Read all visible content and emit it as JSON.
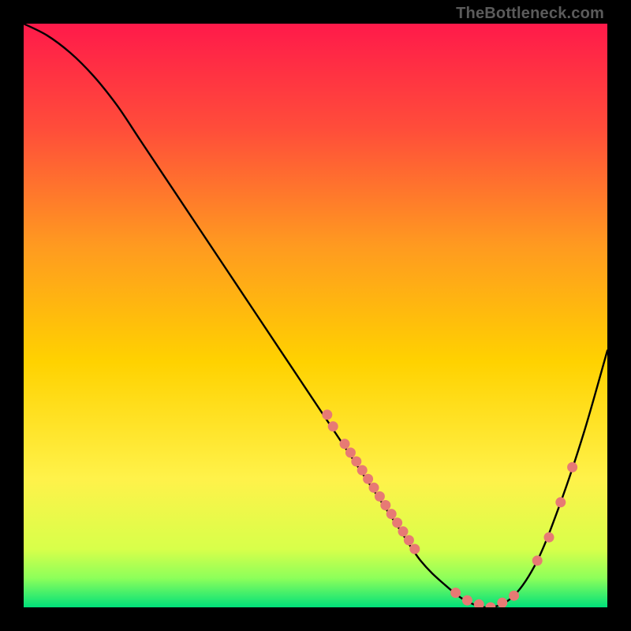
{
  "watermark": "TheBottleneck.com",
  "colors": {
    "gradient_top": "#ff1a4a",
    "gradient_mid1": "#ff6a2e",
    "gradient_mid2": "#ffd200",
    "gradient_mid3": "#fff24a",
    "gradient_bottom1": "#b6ff5a",
    "gradient_bottom2": "#00e07a",
    "curve": "#000000",
    "dot": "#e77a74",
    "frame": "#000000"
  },
  "chart_data": {
    "type": "line",
    "title": "",
    "xlabel": "",
    "ylabel": "",
    "xlim": [
      0,
      100
    ],
    "ylim": [
      0,
      100
    ],
    "grid": false,
    "legend": false,
    "series": [
      {
        "name": "curve",
        "x": [
          0,
          4,
          8,
          12,
          16,
          20,
          24,
          28,
          32,
          36,
          40,
          44,
          48,
          52,
          56,
          60,
          64,
          68,
          72,
          76,
          80,
          84,
          88,
          92,
          96,
          100
        ],
        "y": [
          100,
          98,
          95,
          91,
          86,
          80,
          74,
          68,
          62,
          56,
          50,
          44,
          38,
          32,
          26,
          20,
          14,
          8,
          4,
          1,
          0,
          2,
          8,
          18,
          30,
          44
        ]
      }
    ],
    "dots": {
      "name": "highlighted-points",
      "x": [
        52,
        53,
        55,
        56,
        57,
        58,
        59,
        60,
        61,
        62,
        63,
        64,
        65,
        66,
        67,
        74,
        76,
        78,
        80,
        82,
        84,
        88,
        90,
        92,
        94
      ],
      "y": [
        33,
        31,
        28,
        26.5,
        25,
        23.5,
        22,
        20.5,
        19,
        17.5,
        16,
        14.5,
        13,
        11.5,
        10,
        2.5,
        1.2,
        0.5,
        0,
        0.8,
        2,
        8,
        12,
        18,
        24
      ]
    }
  }
}
